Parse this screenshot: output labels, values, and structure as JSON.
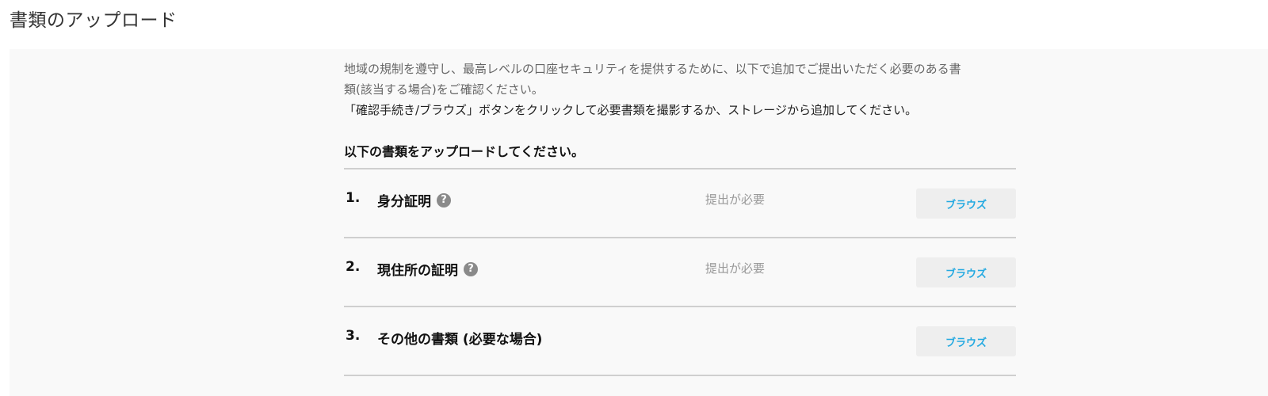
{
  "page": {
    "title": "書類のアップロード"
  },
  "intro": {
    "line1": "地域の規制を遵守し、最高レベルの口座セキュリティを提供するために、以下で追加でご提出いただく必要のある書",
    "line2": "類(該当する場合)をご確認ください。",
    "instruction": "「確認手続き/ブラウズ」ボタンをクリックして必要書類を撮影するか、ストレージから追加してください。"
  },
  "documents": {
    "heading": "以下の書類をアップロードしてください。",
    "items": [
      {
        "number": "1.",
        "label": "身分証明",
        "status": "提出が必要",
        "button": "ブラウズ",
        "help": "?"
      },
      {
        "number": "2.",
        "label": "現住所の証明",
        "status": "提出が必要",
        "button": "ブラウズ",
        "help": "?"
      },
      {
        "number": "3.",
        "label": "その他の書類 (必要な場合)",
        "status": "",
        "button": "ブラウズ"
      }
    ]
  },
  "colors": {
    "button_text": "#23a9e1",
    "button_bg": "#eeeeee",
    "panel_bg": "#f9f9f9"
  }
}
